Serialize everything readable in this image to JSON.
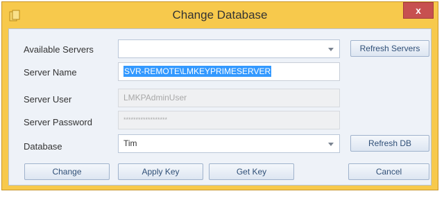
{
  "window": {
    "title": "Change Database",
    "close_label": "x"
  },
  "colors": {
    "frame": "#f7c94c",
    "client": "#eef2f8",
    "selection": "#3399ff",
    "close": "#c75050"
  },
  "form": {
    "available_servers": {
      "label": "Available Servers",
      "value": ""
    },
    "server_name": {
      "label": "Server Name",
      "value": "SVR-REMOTE\\LMKEYPRIMESERVER"
    },
    "server_user": {
      "label": "Server User",
      "value": "LMKPAdminUser"
    },
    "server_password": {
      "label": "Server Password",
      "value": "******************"
    },
    "database": {
      "label": "Database",
      "value": "Tim"
    }
  },
  "buttons": {
    "refresh_servers": "Refresh Servers",
    "refresh_db": "Refresh DB",
    "change": "Change",
    "apply_key": "Apply Key",
    "get_key": "Get Key",
    "cancel": "Cancel"
  }
}
